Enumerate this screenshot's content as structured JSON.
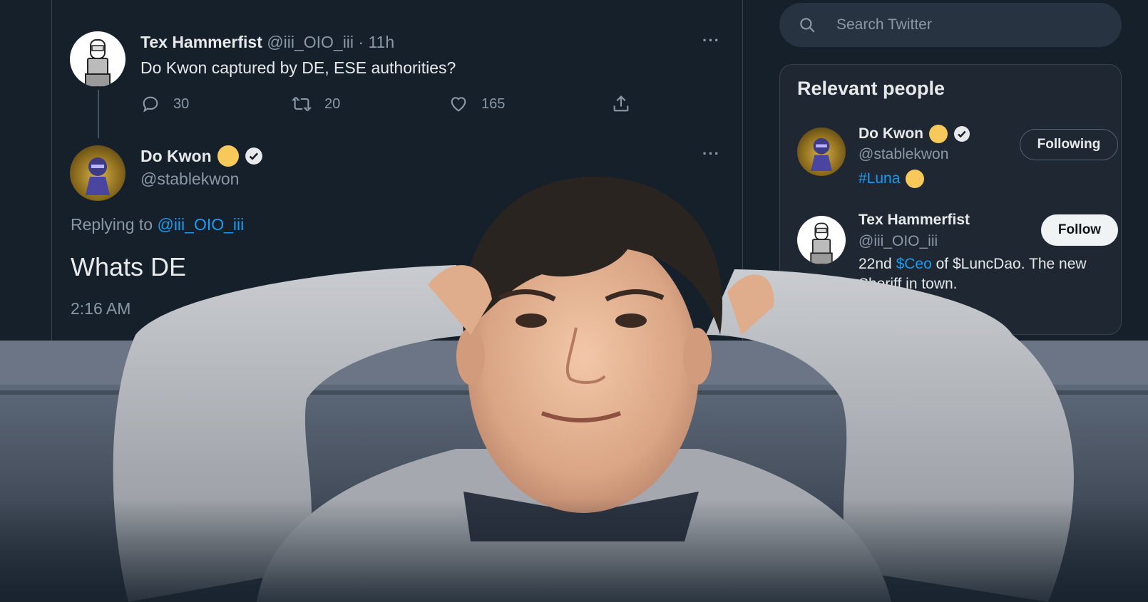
{
  "tweet": {
    "author_name": "Tex Hammerfist",
    "author_handle": "@iii_OIO_iii",
    "age": "· 11h",
    "text": "Do Kwon captured by DE, ESE authorities?",
    "replies": "30",
    "retweets": "20",
    "likes": "165"
  },
  "reply": {
    "author_name": "Do Kwon",
    "author_handle": "@stablekwon",
    "replying_label": "Replying to",
    "replying_to": "@iii_OIO_iii",
    "text": "Whats DE",
    "time": "2:16 AM"
  },
  "search": {
    "placeholder": "Search Twitter"
  },
  "relevant_people": {
    "title": "Relevant people",
    "people": [
      {
        "name": "Do Kwon",
        "handle": "@stablekwon",
        "bio_tag": "#Luna",
        "button": "Following"
      },
      {
        "name": "Tex Hammerfist",
        "handle": "@iii_OIO_iii",
        "bio_start": "22nd",
        "bio_tag": "$Ceo",
        "bio_rest": "of $LuncDao. The new",
        "bio_line2": "Sheriff in town.",
        "button": "Follow"
      }
    ]
  },
  "colors": {
    "background": "#15202b",
    "link": "#1d9bf0",
    "coin": "#f7c95b"
  }
}
